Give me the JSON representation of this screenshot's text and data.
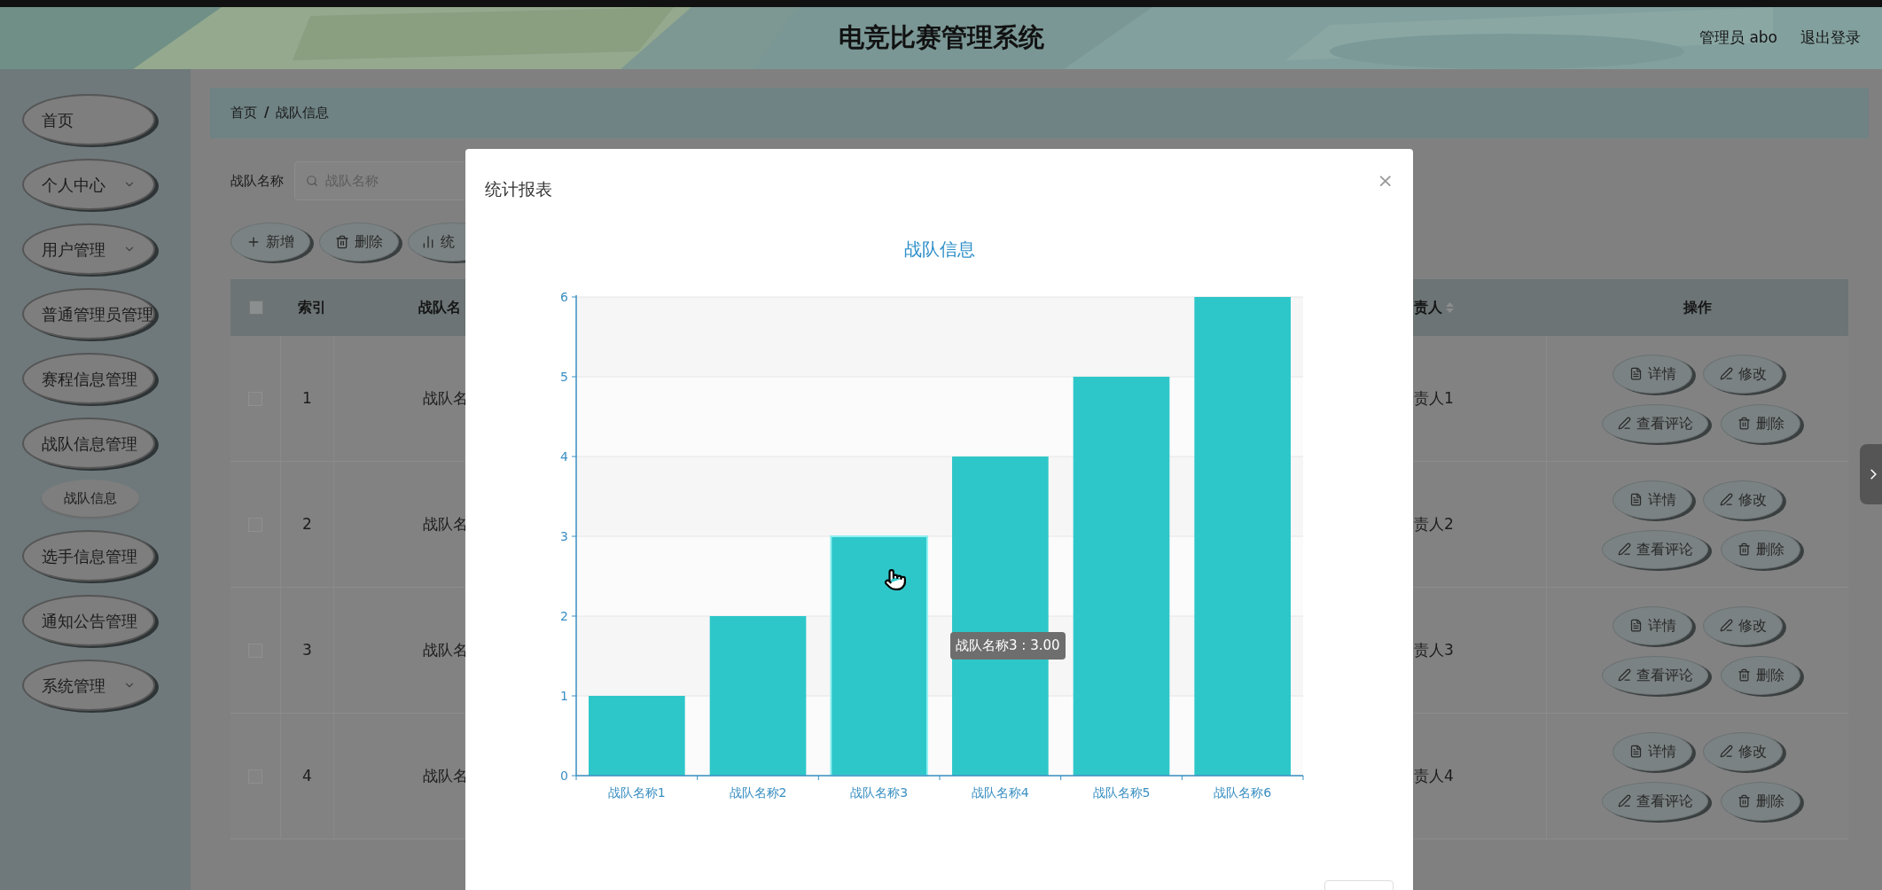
{
  "header": {
    "title": "电竞比赛管理系统",
    "user": "管理员 abo",
    "logout": "退出登录"
  },
  "sidebar": {
    "items": [
      {
        "label": "首页",
        "kind": "link"
      },
      {
        "label": "个人中心",
        "kind": "submenu"
      },
      {
        "label": "用户管理",
        "kind": "submenu"
      },
      {
        "label": "普通管理员管理",
        "kind": "link"
      },
      {
        "label": "赛程信息管理",
        "kind": "link"
      },
      {
        "label": "战队信息管理",
        "kind": "submenu",
        "children": [
          {
            "label": "战队信息"
          }
        ]
      },
      {
        "label": "选手信息管理",
        "kind": "link"
      },
      {
        "label": "通知公告管理",
        "kind": "link"
      },
      {
        "label": "系统管理",
        "kind": "submenu"
      }
    ]
  },
  "breadcrumb": [
    "首页",
    "/",
    "战队信息"
  ],
  "search": {
    "label": "战队名称",
    "placeholder": "战队名称"
  },
  "toolbar": [
    {
      "label": "新增",
      "kind": "add"
    },
    {
      "label": "删除",
      "kind": "delete"
    },
    {
      "label": "统",
      "kind": "chart"
    }
  ],
  "table": {
    "select_all": {
      "checked": false
    },
    "columns": [
      {
        "label": "索引"
      },
      {
        "label": "战队名"
      },
      {
        "label": "责人",
        "sortable": true
      },
      {
        "label": "操作"
      }
    ],
    "rows": [
      {
        "index": "1",
        "name": "战队名",
        "leader": "责人1",
        "checked": false,
        "actions": [
          "详情",
          "修改",
          "查看评论",
          "删除"
        ]
      },
      {
        "index": "2",
        "name": "战队名",
        "leader": "责人2",
        "checked": false,
        "actions": [
          "详情",
          "修改",
          "查看评论",
          "删除"
        ]
      },
      {
        "index": "3",
        "name": "战队名",
        "leader": "责人3",
        "checked": false,
        "actions": [
          "详情",
          "修改",
          "查看评论",
          "删除"
        ]
      },
      {
        "index": "4",
        "name": "战队名",
        "leader": "责人4",
        "checked": false,
        "actions": [
          "详情",
          "修改",
          "查看评论",
          "删除"
        ]
      }
    ]
  },
  "dialog": {
    "title": "统计报表",
    "close": "×",
    "chart_data": {
      "type": "bar",
      "title": "战队信息",
      "categories": [
        "战队名称1",
        "战队名称2",
        "战队名称3",
        "战队名称4",
        "战队名称5",
        "战队名称6"
      ],
      "values": [
        1,
        2,
        3,
        4,
        5,
        6
      ],
      "ylim": [
        0,
        6
      ],
      "yticks": [
        0,
        1,
        2,
        3,
        4,
        5,
        6
      ],
      "grid": true
    },
    "hover": [
      {
        "hovered": false
      },
      {
        "hovered": false
      },
      {
        "hovered": true
      },
      {
        "hovered": false
      },
      {
        "hovered": false
      },
      {
        "hovered": false
      }
    ],
    "tooltip": {
      "text": "战队名称3 : 3.00"
    }
  }
}
